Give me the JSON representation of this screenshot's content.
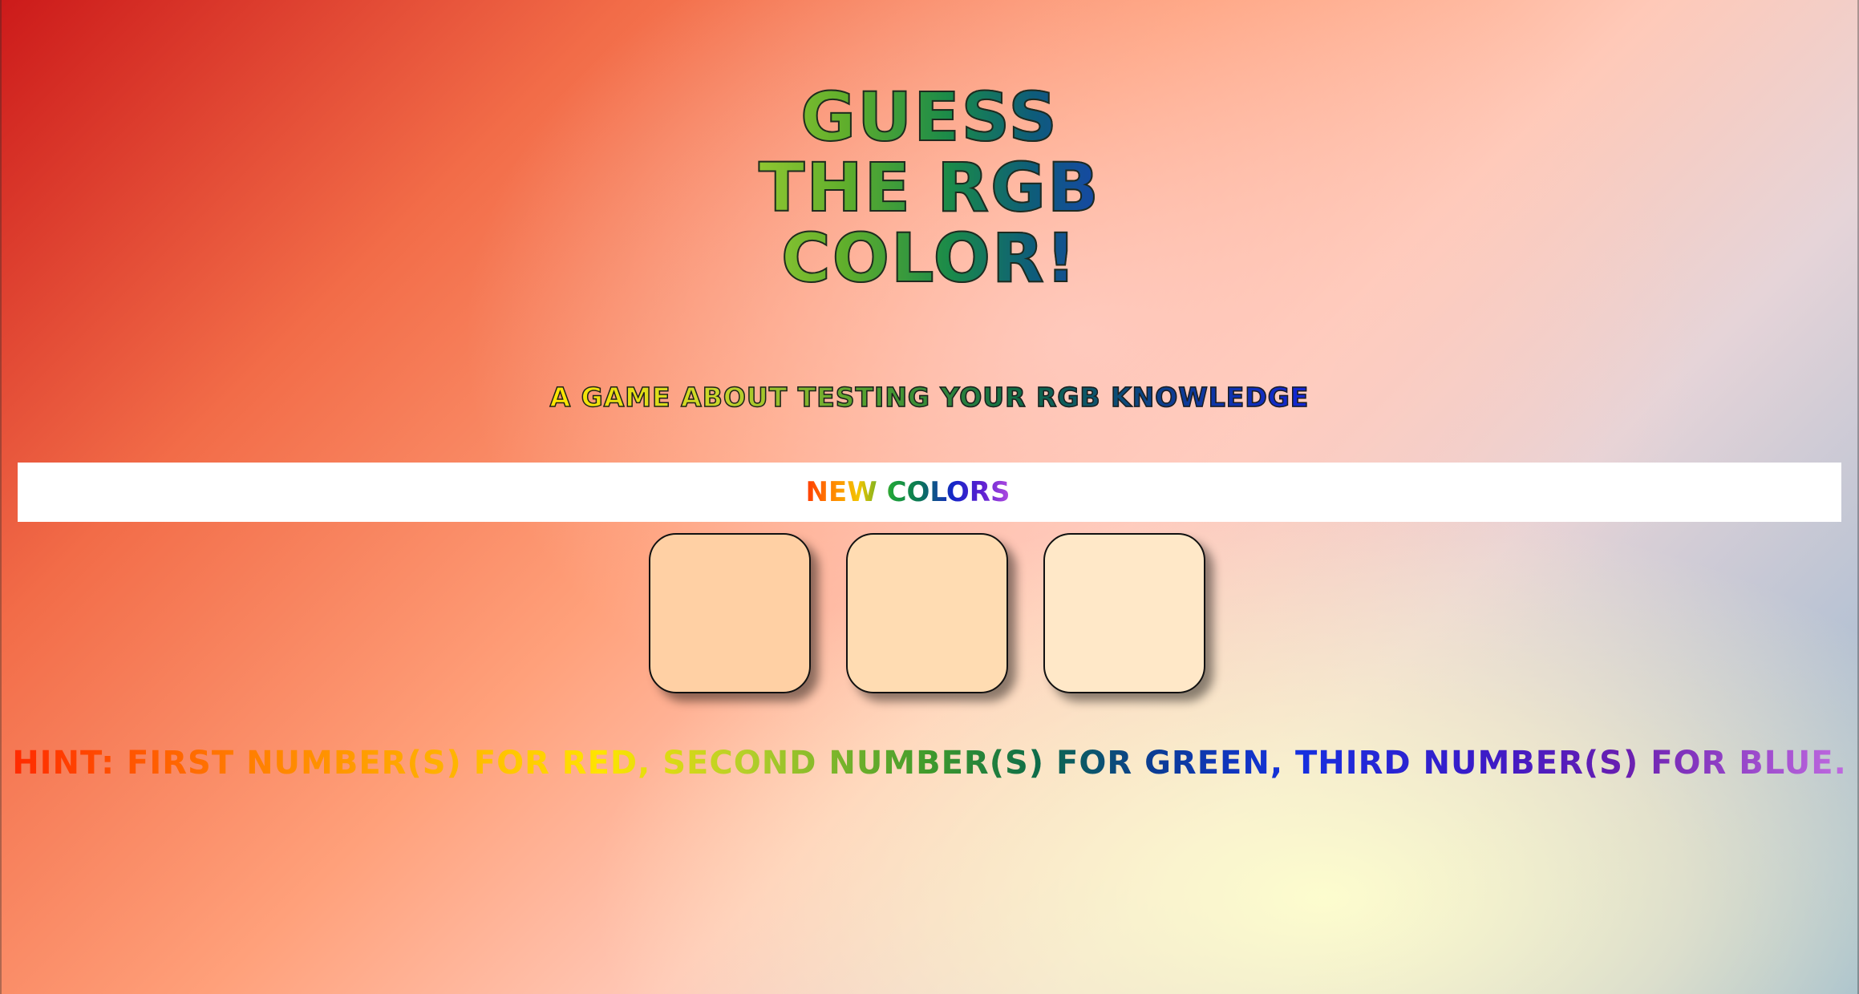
{
  "title": "GUESS THE RGB COLOR!",
  "subtitle": "A GAME ABOUT TESTING YOUR RGB KNOWLEDGE",
  "toolbar": {
    "new_colors_label": "NEW COLORS"
  },
  "tiles": [
    {
      "color": "#ffd0a4"
    },
    {
      "color": "#ffdcb2"
    },
    {
      "color": "#ffe8c8"
    }
  ],
  "hint": "HINT: FIRST NUMBER(S) FOR RED, SECOND NUMBER(S) FOR GREEN, THIRD NUMBER(S) FOR BLUE.",
  "colors": {
    "background_top_left": "#cc1a1a",
    "background_top_right": "#8fb3cf",
    "background_bottom": "#ffffcd",
    "bar": "#ffffff"
  }
}
